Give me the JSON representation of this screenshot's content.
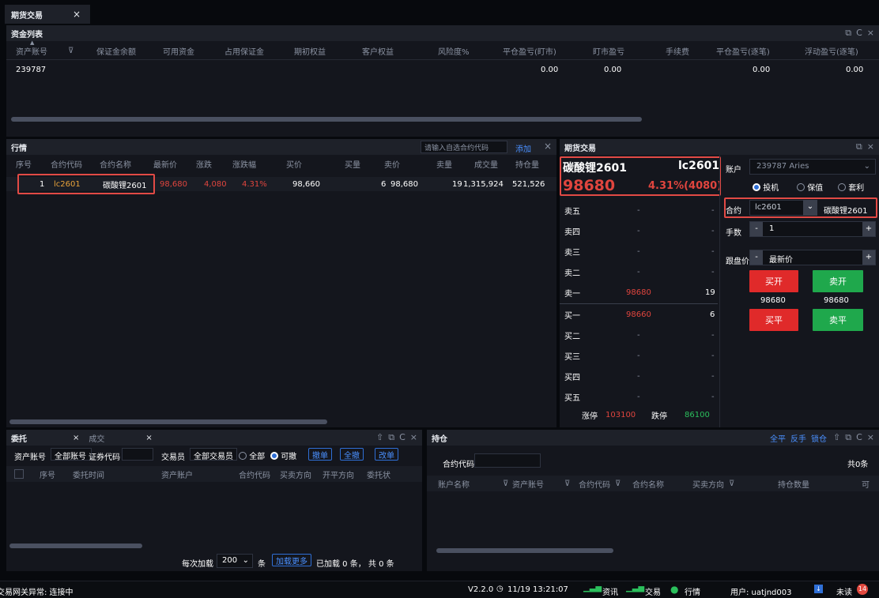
{
  "top_tab": {
    "label": "期货交易",
    "close": "×"
  },
  "fund": {
    "title": "资金列表",
    "controls": [
      "⧉",
      "C",
      "×"
    ],
    "columns": [
      "资产账号",
      "保证金余额",
      "可用资金",
      "占用保证金",
      "期初权益",
      "客户权益",
      "风险度%",
      "平仓盈亏(盯市)",
      "盯市盈亏",
      "手续费",
      "平仓盈亏(逐笔)",
      "浮动盈亏(逐笔)"
    ],
    "row": {
      "account": "239787",
      "close_pl_mark": "0.00",
      "mark_pl": "0.00",
      "close_pl_trade": "0.00",
      "float_pl": "0.00"
    }
  },
  "quote": {
    "title": "行情",
    "search_placeholder": "请输入自选合约代码",
    "add_label": "添加",
    "columns": [
      "序号",
      "合约代码",
      "合约名称",
      "最新价",
      "涨跌",
      "涨跌幅",
      "买价",
      "买量",
      "卖价",
      "卖量",
      "成交量",
      "持仓量"
    ],
    "row": {
      "seq": "1",
      "code": "lc2601",
      "name": "碳酸锂2601",
      "last": "98,680",
      "change": "4,080",
      "pct": "4.31%",
      "bid": "98,660",
      "bid_vol": "6",
      "ask": "98,680",
      "ask_vol": "19",
      "volume": "1,315,924",
      "oi": "521,526"
    }
  },
  "trade": {
    "title": "期货交易",
    "controls": [
      "⧉",
      "×"
    ],
    "name": "碳酸锂2601",
    "code": "lc2601",
    "price": "98680",
    "change": "4.31%(4080)",
    "depth": [
      {
        "label": "卖五",
        "price": "-",
        "vol": "-"
      },
      {
        "label": "卖四",
        "price": "-",
        "vol": "-"
      },
      {
        "label": "卖三",
        "price": "-",
        "vol": "-"
      },
      {
        "label": "卖二",
        "price": "-",
        "vol": "-"
      },
      {
        "label": "卖一",
        "price": "98680",
        "vol": "19"
      },
      {
        "label": "买一",
        "price": "98660",
        "vol": "6"
      },
      {
        "label": "买二",
        "price": "-",
        "vol": "-"
      },
      {
        "label": "买三",
        "price": "-",
        "vol": "-"
      },
      {
        "label": "买四",
        "price": "-",
        "vol": "-"
      },
      {
        "label": "买五",
        "price": "-",
        "vol": "-"
      }
    ],
    "limit_up_label": "涨停",
    "limit_up": "103100",
    "limit_down_label": "跌停",
    "limit_down": "86100",
    "account_label": "账户",
    "account_value": "239787 Aries",
    "hedge_options": [
      "投机",
      "保值",
      "套利"
    ],
    "contract_label": "合约",
    "contract_code": "lc2601",
    "contract_name": "碳酸锂2601",
    "qty_label": "手数",
    "qty_value": "1",
    "price_label": "跟盘价",
    "price_value": "最新价",
    "buy_open": "买开",
    "sell_open": "卖开",
    "buy_open_price": "98680",
    "sell_open_price": "98680",
    "buy_close": "买平",
    "sell_close": "卖平"
  },
  "orders": {
    "tabs": [
      "委托",
      "成交"
    ],
    "controls": [
      "⇧",
      "⧉",
      "C",
      "×"
    ],
    "filter_account_label": "资产账号",
    "filter_account_value": "全部账号",
    "filter_code_label": "证券代码",
    "trader_label": "交易员",
    "trader_value": "全部交易员",
    "radio_all": "全部",
    "radio_cancelable": "可撤",
    "btn_cancel": "撤单",
    "btn_cancel_all": "全撤",
    "btn_modify": "改单",
    "columns": [
      "序号",
      "委托时间",
      "资产账户",
      "合约代码",
      "买卖方向",
      "开平方向",
      "委托状"
    ],
    "load_per": "每次加载",
    "load_count": "200",
    "load_unit": "条",
    "load_more": "加载更多",
    "loaded": "已加载 0 条， 共 0 条"
  },
  "positions": {
    "title": "持仓",
    "actions": [
      "全平",
      "反手",
      "锁仓"
    ],
    "controls": [
      "⇧",
      "⧉",
      "C",
      "×"
    ],
    "filter_label": "合约代码",
    "count": "共0条",
    "columns": [
      "账户名称",
      "资产账号",
      "合约代码",
      "合约名称",
      "买卖方向",
      "持仓数量",
      "可"
    ]
  },
  "status": {
    "left": "交易网关异常: 连接中",
    "version": "V2.2.0",
    "datetime": "11/19 13:21:07",
    "info": "资讯",
    "trade": "交易",
    "market": "行情",
    "user": "用户: uatjnd003",
    "unread": "未读",
    "unread_count": "14"
  },
  "colors": {
    "up": "#e0453e",
    "down": "#2bbf5c",
    "accent": "#2f6fd6",
    "highlight": "#e24a45"
  }
}
